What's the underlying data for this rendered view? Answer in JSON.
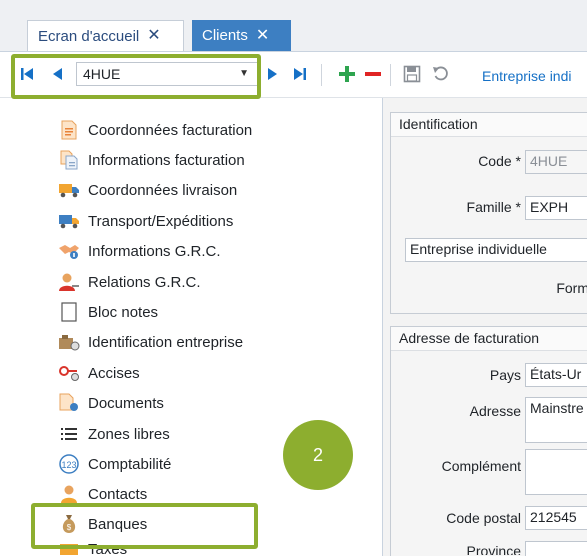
{
  "tabs": [
    {
      "label": "Ecran d'accueil",
      "close": "✕"
    },
    {
      "label": "Clients",
      "close": "✕"
    }
  ],
  "toolbar": {
    "client_code": "4HUE",
    "entity_label": "Entreprise indi"
  },
  "menu": {
    "items": [
      {
        "label": "Coordonnées facturation",
        "icon": "invoice-icon"
      },
      {
        "label": "Informations facturation",
        "icon": "document-info-icon"
      },
      {
        "label": "Coordonnées livraison",
        "icon": "truck-icon"
      },
      {
        "label": "Transport/Expéditions",
        "icon": "delivery-truck-icon"
      },
      {
        "label": "Informations G.R.C.",
        "icon": "handshake-icon"
      },
      {
        "label": "Relations G.R.C.",
        "icon": "user-relation-icon"
      },
      {
        "label": "Bloc notes",
        "icon": "notepad-icon"
      },
      {
        "label": "Identification entreprise",
        "icon": "company-icon"
      },
      {
        "label": "Accises",
        "icon": "excise-icon"
      },
      {
        "label": "Documents",
        "icon": "documents-icon"
      },
      {
        "label": "Zones libres",
        "icon": "list-icon"
      },
      {
        "label": "Comptabilité",
        "icon": "accounting-icon"
      },
      {
        "label": "Contacts",
        "icon": "contact-icon"
      },
      {
        "label": "Banques",
        "icon": "money-bag-icon"
      },
      {
        "label": "Taxes",
        "icon": "tax-icon"
      }
    ]
  },
  "identification": {
    "header": "Identification",
    "code_label": "Code *",
    "code_value": "4HUE",
    "famille_label": "Famille *",
    "famille_value": "EXPH",
    "type_value": "Entreprise individuelle",
    "forme_label": "Form"
  },
  "adresse": {
    "header": "Adresse de facturation",
    "pays_label": "Pays",
    "pays_value": "États-Ur",
    "adresse_label": "Adresse",
    "adresse_value": "Mainstre",
    "complement_label": "Complément",
    "code_postal_label": "Code postal",
    "code_postal_value": "212545",
    "province_label": "Province"
  },
  "badge": {
    "number": "2"
  },
  "colors": {
    "accent": "#3d7fc2",
    "highlight": "#8dae2f",
    "link": "#1570c6"
  }
}
